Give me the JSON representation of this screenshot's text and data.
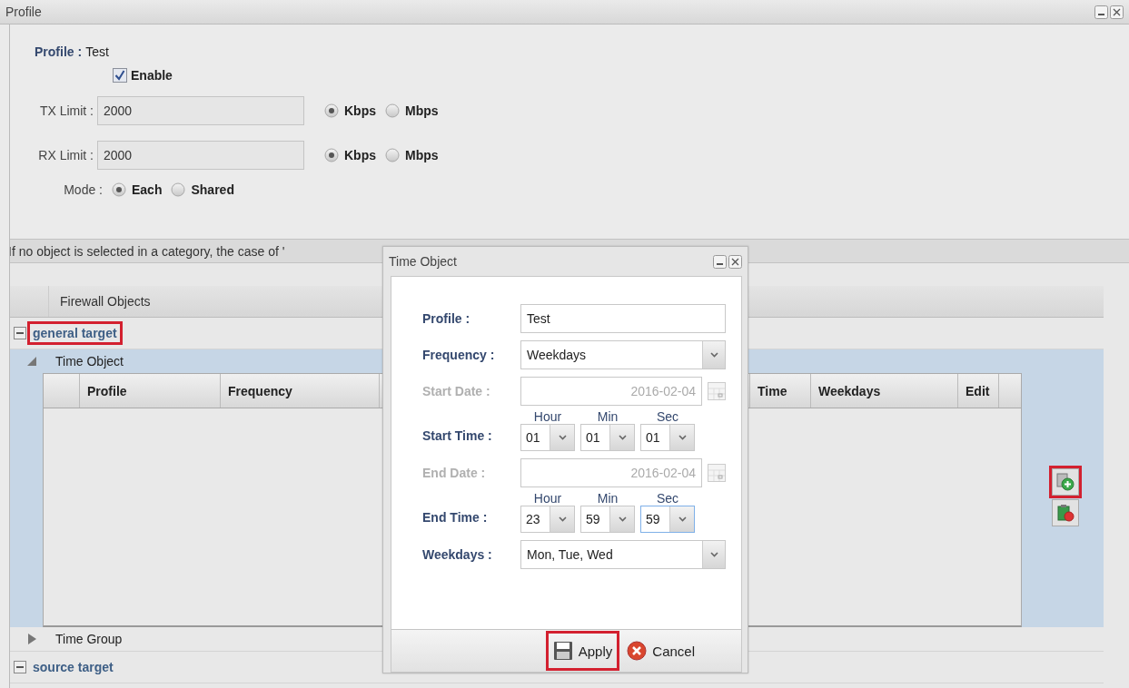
{
  "window": {
    "title": "Profile"
  },
  "profile_form": {
    "profile_label": "Profile :",
    "profile_value": "Test",
    "enable": {
      "label": "Enable",
      "checked": true
    },
    "limits": [
      {
        "label": "TX Limit :",
        "value": "2000",
        "units": [
          {
            "label": "Kbps",
            "selected": true
          },
          {
            "label": "Mbps",
            "selected": false
          }
        ]
      },
      {
        "label": "RX Limit :",
        "value": "2000",
        "units": [
          {
            "label": "Kbps",
            "selected": true
          },
          {
            "label": "Mbps",
            "selected": false
          }
        ]
      }
    ],
    "mode": {
      "label": "Mode :",
      "options": [
        {
          "label": "Each",
          "selected": true
        },
        {
          "label": "Shared",
          "selected": false
        }
      ]
    }
  },
  "note": "If no object is selected in a category, the case of '",
  "objects_header": "Firewall Objects",
  "tree": [
    {
      "label": "general target",
      "expanded": true,
      "highlighted": true,
      "children": [
        {
          "label": "Time Object",
          "expanded": true,
          "table": {
            "columns": [
              "Profile",
              "Frequency",
              "",
              "Time",
              "Weekdays",
              "Edit"
            ]
          }
        },
        {
          "label": "Time Group",
          "expanded": false
        }
      ]
    },
    {
      "label": "source target",
      "expanded": true,
      "highlighted": false
    }
  ],
  "side_buttons": [
    {
      "kind": "add",
      "highlighted": true
    },
    {
      "kind": "delete",
      "highlighted": false
    }
  ],
  "dialog": {
    "title": "Time Object",
    "fields": [
      {
        "kind": "text",
        "label": "Profile :",
        "value": "Test",
        "disabled": false
      },
      {
        "kind": "select",
        "label": "Frequency :",
        "value": "Weekdays",
        "disabled": false
      },
      {
        "kind": "date",
        "label": "Start Date :",
        "value": "2016-02-04",
        "disabled": true
      },
      {
        "kind": "time",
        "label": "Start Time :",
        "disabled": false,
        "parts": [
          {
            "label": "Hour",
            "value": "01",
            "focused": false
          },
          {
            "label": "Min",
            "value": "01",
            "focused": false
          },
          {
            "label": "Sec",
            "value": "01",
            "focused": false
          }
        ]
      },
      {
        "kind": "date",
        "label": "End Date :",
        "value": "2016-02-04",
        "disabled": true
      },
      {
        "kind": "time",
        "label": "End Time :",
        "disabled": false,
        "parts": [
          {
            "label": "Hour",
            "value": "23",
            "focused": false
          },
          {
            "label": "Min",
            "value": "59",
            "focused": false
          },
          {
            "label": "Sec",
            "value": "59",
            "focused": true
          }
        ]
      },
      {
        "kind": "select",
        "label": "Weekdays :",
        "value": "Mon, Tue, Wed",
        "disabled": false
      }
    ],
    "buttons": [
      {
        "kind": "apply",
        "label": "Apply",
        "highlighted": true
      },
      {
        "kind": "cancel",
        "label": "Cancel",
        "highlighted": false
      }
    ]
  }
}
